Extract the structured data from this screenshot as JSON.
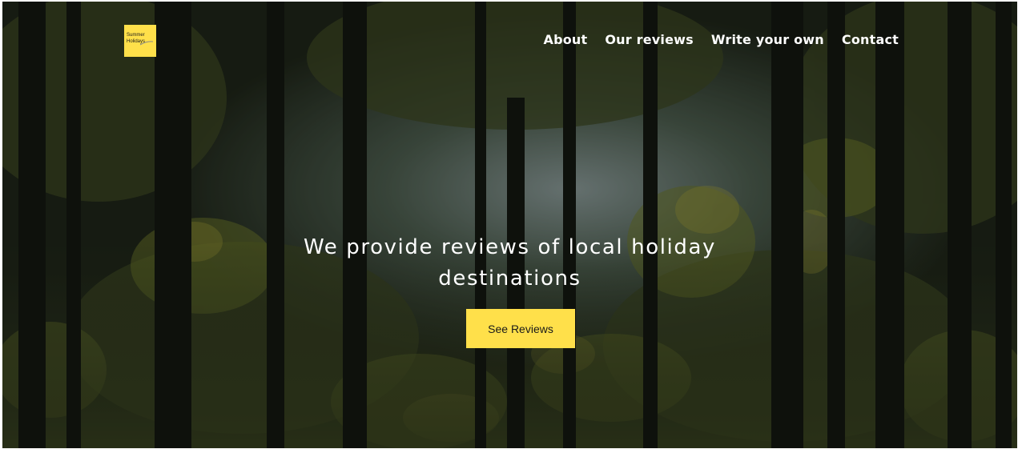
{
  "logo": {
    "line1": "Summer",
    "line2": "Holidays"
  },
  "nav": {
    "items": [
      {
        "label": "About"
      },
      {
        "label": "Our reviews"
      },
      {
        "label": "Write your own"
      },
      {
        "label": "Contact"
      }
    ]
  },
  "hero": {
    "headline_line1": "We provide reviews of local holiday",
    "headline_line2": "destinations",
    "cta_label": "See Reviews"
  },
  "colors": {
    "accent": "#ffe04a",
    "nav_text": "#ffffff"
  },
  "icons": {
    "background": "forest-photo"
  }
}
